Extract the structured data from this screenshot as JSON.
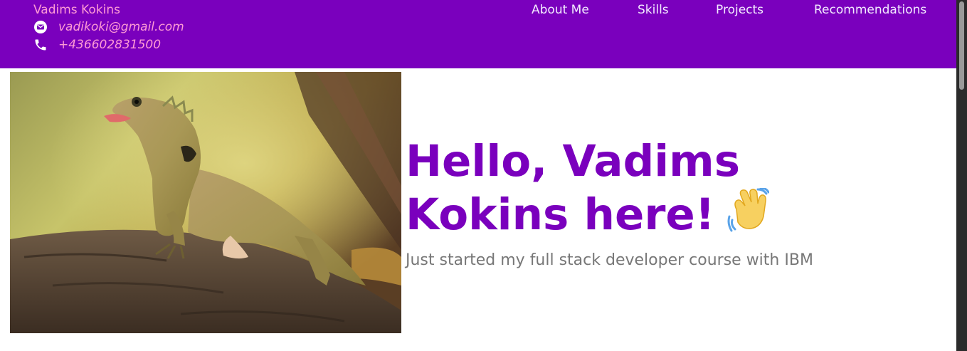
{
  "colors": {
    "header_bg": "#7a00bd",
    "brand_text": "#ff9ad5",
    "nav_text": "#f3e9ff",
    "title_text": "#7a00bd",
    "subtitle_text": "#777777"
  },
  "header": {
    "name": "Vadims Kokins",
    "email": "vadikoki@gmail.com",
    "phone": "+436602831500",
    "email_icon": "envelope-icon",
    "phone_icon": "phone-icon",
    "nav": [
      "About Me",
      "Skills",
      "Projects",
      "Recommendations"
    ]
  },
  "hero": {
    "image": "lizard-on-branch-photo",
    "title": "Hello, Vadims Kokins here!",
    "title_emoji": "waving-hand-icon",
    "subtitle": "Just started my full stack developer course with IBM"
  }
}
